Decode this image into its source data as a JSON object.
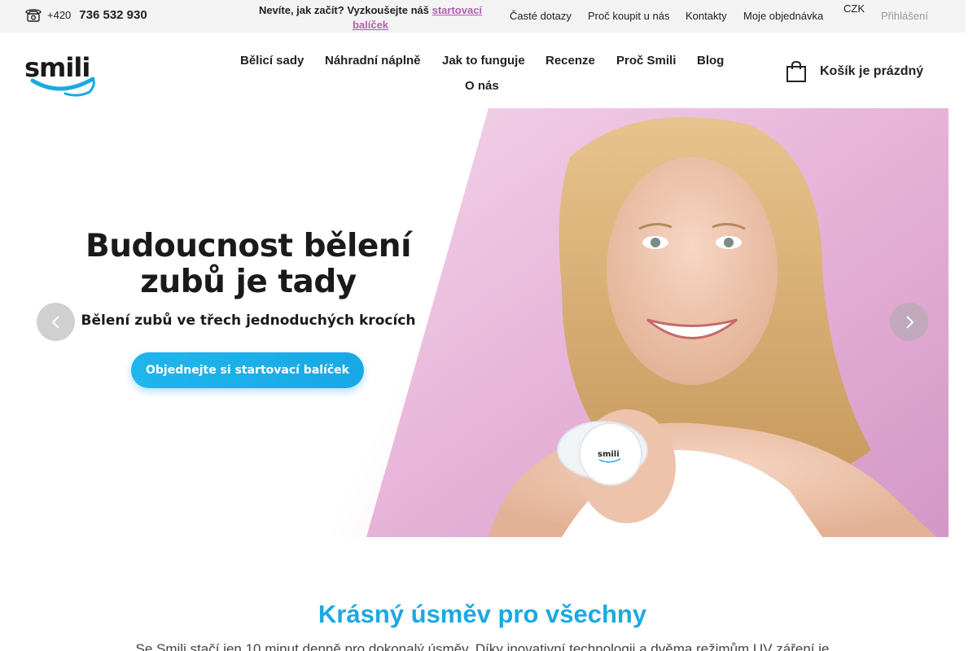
{
  "topbar": {
    "phone_prefix": "+420",
    "phone_number": "736 532 930",
    "promo_text": "Nevíte, jak začít? Vyzkoušejte náš",
    "promo_link": "startovací balíček",
    "links": [
      "Časté dotazy",
      "Proč koupit u nás",
      "Kontakty",
      "Moje objednávka"
    ],
    "currency": "CZK",
    "login_icon": "",
    "login": "Přihlášení"
  },
  "header": {
    "logo_text": "smili",
    "nav": [
      "Bělicí sady",
      "Náhradní náplně",
      "Jak to funguje",
      "Recenze",
      "Proč Smili",
      "Blog",
      "O nás"
    ],
    "cart_label": "Košík je prázdný"
  },
  "hero": {
    "title_line1": "Budoucnost bělení",
    "title_line2": "zubů je tady",
    "subtitle": "Bělení zubů ve třech jednoduchých krocích",
    "cta": "Objednejte si startovací balíček",
    "device_text": "smili",
    "prev_icon": "chevron-left-icon",
    "next_icon": "chevron-right-icon"
  },
  "section": {
    "title": "Krásný úsměv pro všechny",
    "text": "Se Smili stačí jen 10 minut denně pro dokonalý úsměv. Díky inovativní technologii a dvěma režimům UV záření je"
  },
  "colors": {
    "accent": "#1ba9e2",
    "link": "#b15fb3",
    "topbar_bg": "#f3f3f3"
  }
}
